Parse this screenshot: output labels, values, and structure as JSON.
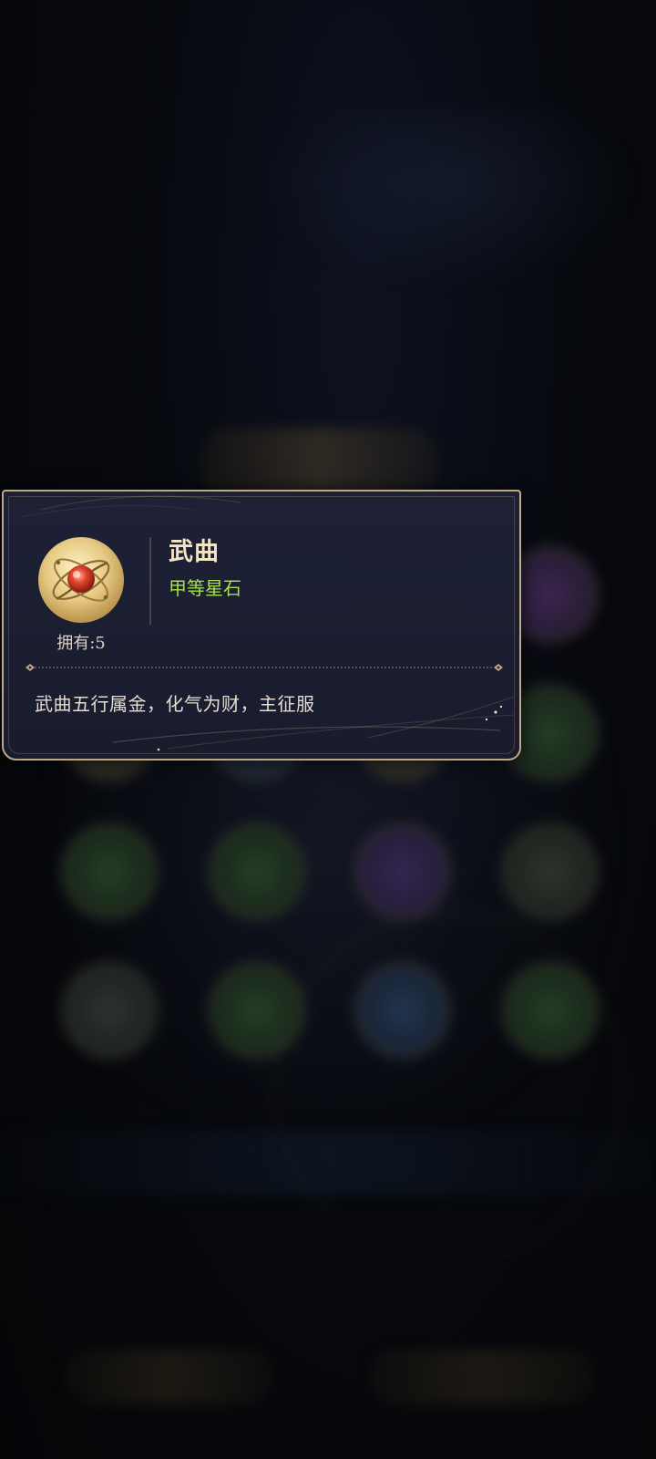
{
  "item": {
    "name": "武曲",
    "grade": "甲等星石",
    "owned_label": "拥有:5",
    "description": "武曲五行属金，化气为财，主征服",
    "icon": "golden-star-stone-gem-icon"
  },
  "colors": {
    "name": "#f3e5c4",
    "grade": "#a6e043",
    "frame": "#bfa887",
    "panel": "#1e2136"
  }
}
